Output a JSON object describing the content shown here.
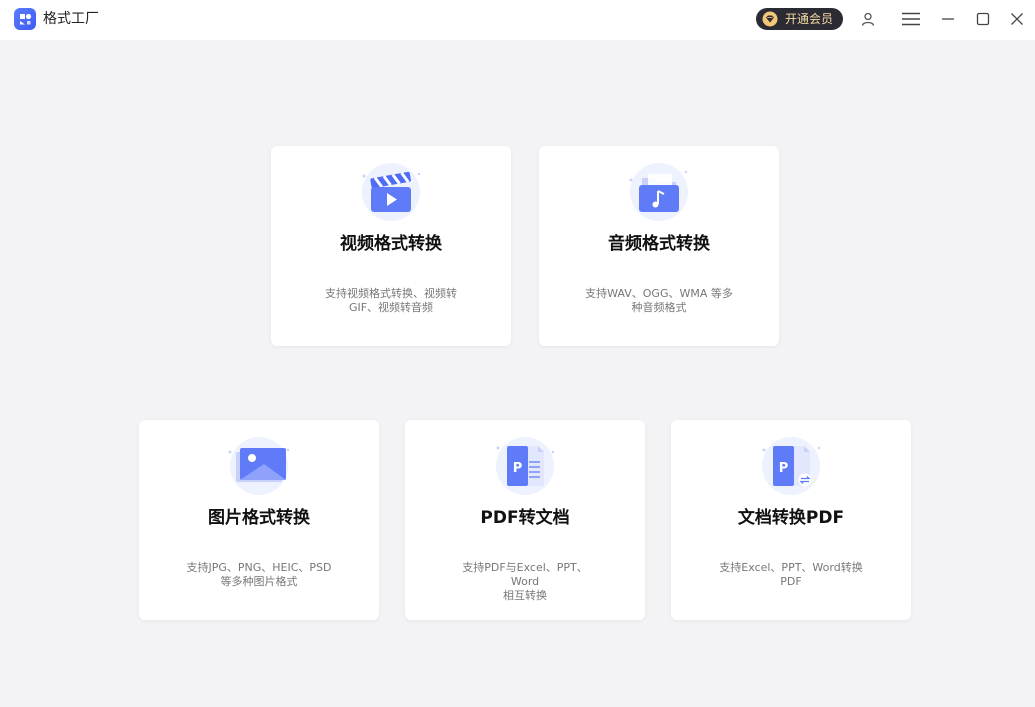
{
  "app": {
    "title": "格式工厂",
    "vip_label": "开通会员"
  },
  "colors": {
    "accent": "#4f6cf7",
    "vip_bg": "#2b2b33",
    "vip_text": "#f5d9a6",
    "background": "#f3f3f6"
  },
  "titlebar_icons": [
    "user-icon",
    "menu-icon",
    "minimize-icon",
    "maximize-icon",
    "close-icon"
  ],
  "cards": [
    {
      "icon": "video-clapper-icon",
      "title": "视频格式转换",
      "desc_line1": "支持视频格式转换、视频转",
      "desc_line2": "GIF、视频转音频"
    },
    {
      "icon": "audio-folder-icon",
      "title": "音频格式转换",
      "desc_line1": "支持WAV、OGG、WMA 等多",
      "desc_line2": "种音频格式"
    },
    {
      "icon": "image-icon",
      "title": "图片格式转换",
      "desc_line1": "支持JPG、PNG、HEIC、PSD",
      "desc_line2": "等多种图片格式"
    },
    {
      "icon": "pdf-to-doc-icon",
      "title": "PDF转文档",
      "desc_line1": "支持PDF与Excel、PPT、Word",
      "desc_line2": "相互转换"
    },
    {
      "icon": "doc-to-pdf-icon",
      "title": "文档转换PDF",
      "desc_line1": "支持Excel、PPT、Word转换",
      "desc_line2": "PDF"
    }
  ]
}
